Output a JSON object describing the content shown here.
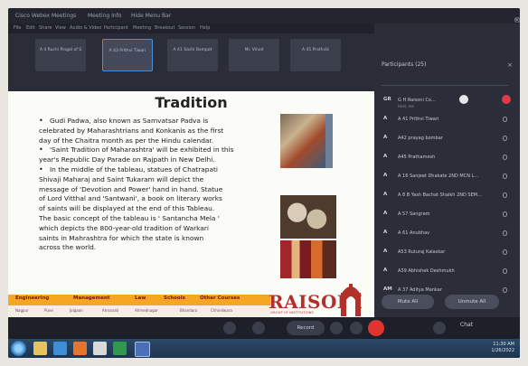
{
  "window": {
    "title_parts": [
      "Cisco Webex Meetings",
      "Meeting Info",
      "Hide Menu Bar"
    ],
    "controls": [
      "-",
      "▢",
      "×"
    ]
  },
  "menubar": [
    "File",
    "Edit",
    "Share",
    "View",
    "Audio & Video",
    "Participant",
    "Meeting",
    "Breakout",
    "Session",
    "Help"
  ],
  "thumbnails": [
    "A 4 Ruchi Pingal of S",
    "A 43 Prithvi Tiwari",
    "A 41 Sachi Bompat",
    "Mr. Vinod",
    "A 45 Prathvik"
  ],
  "slide": {
    "title": "Tradition",
    "bullets": [
      {
        "type": "bullet",
        "text": "Gudi Padwa, also known as Samvatsar Padva is"
      },
      {
        "type": "cont",
        "text": "celebrated by Maharashtrians and Konkanis as the first"
      },
      {
        "type": "cont",
        "text": "day of the Chaitra month as per the Hindu calendar."
      },
      {
        "type": "bullet",
        "text": "'Saint Tradition of Maharashtra' will be exhibited in this"
      },
      {
        "type": "cont",
        "text": "year's Republic Day Parade on Rajpath in New Delhi."
      },
      {
        "type": "bullet",
        "text": "In the middle of the tableau, statues of Chatrapati"
      },
      {
        "type": "cont",
        "text": "Shivaji Maharaj and Saint Tukaram will depict the"
      },
      {
        "type": "cont",
        "text": "message of 'Devotion and Power' hand in hand. Statue"
      },
      {
        "type": "cont",
        "text": "of Lord Vitthal and 'Santwani', a book on literary works"
      },
      {
        "type": "cont",
        "text": "of saints will be displayed at the end of this Tableau."
      },
      {
        "type": "cont",
        "text": "The basic concept of the tableau is ' Santancha Mela '"
      },
      {
        "type": "cont",
        "text": "which depicts the 800-year-old tradition of Warkari"
      },
      {
        "type": "cont",
        "text": "saints in Mahrashtra for which the state is known"
      },
      {
        "type": "cont",
        "text": "across the world."
      }
    ],
    "footer_categories": [
      "Engineering",
      "Management",
      "Law",
      "Schools",
      "Other Courses"
    ],
    "footer_locations": [
      "Nagpur",
      "Pune",
      "Jalgaon",
      "Amravati",
      "Ahmednagar",
      "Bhandara",
      "Chhindwara"
    ],
    "logo_text": "RAISONI",
    "logo_sub": "GROUP OF INSTITUTIONS"
  },
  "panel": {
    "header": "Participants (25)",
    "close": "×",
    "participants": [
      {
        "initials": "GR",
        "name": "G H Raisoni Co...",
        "sub": "Host, me",
        "badges": true
      },
      {
        "initials": "A",
        "name": "A 41 Prithvi Tiwari",
        "sub": ""
      },
      {
        "initials": "A",
        "name": "A42 prayag bombar",
        "sub": ""
      },
      {
        "initials": "A",
        "name": "A45 Prathamesh",
        "sub": ""
      },
      {
        "initials": "A",
        "name": "A 16 Sanjeet Dhakate 2ND MCN L...",
        "sub": ""
      },
      {
        "initials": "A",
        "name": "A 8 B Yash Bachat Shaikh 2ND SEM...",
        "sub": ""
      },
      {
        "initials": "A",
        "name": "A 57 Sangram",
        "sub": ""
      },
      {
        "initials": "A",
        "name": "A 61 Anubhav",
        "sub": ""
      },
      {
        "initials": "A",
        "name": "A53 Ruturaj Kalaskar",
        "sub": ""
      },
      {
        "initials": "A",
        "name": "A39 Abhishek Deshmukh",
        "sub": ""
      },
      {
        "initials": "AM",
        "name": "A 37 Aditya Mankar",
        "sub": ""
      }
    ],
    "buttons": [
      "Mute All",
      "Unmute All"
    ]
  },
  "tray": {
    "record": "Record",
    "chat": "Chat"
  },
  "taskbar": {
    "time": "11:30 AM",
    "date": "1/26/2022"
  }
}
